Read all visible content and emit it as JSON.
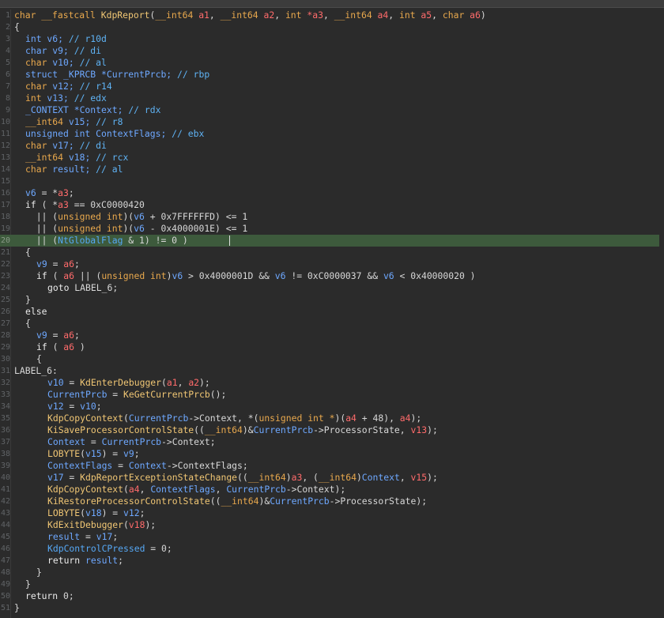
{
  "editor": {
    "highlighted_line": 20,
    "lines": [
      {
        "n": "1",
        "indent": 0,
        "t": [
          [
            "ty",
            "char __fastcall "
          ],
          [
            "fn",
            "KdpReport"
          ],
          [
            "pl",
            "("
          ],
          [
            "ty",
            "__int64"
          ],
          [
            "ar",
            " a1"
          ],
          [
            "pl",
            ", "
          ],
          [
            "ty",
            "__int64"
          ],
          [
            "ar",
            " a2"
          ],
          [
            "pl",
            ", "
          ],
          [
            "ty",
            "int"
          ],
          [
            "ar",
            " *a3"
          ],
          [
            "pl",
            ", "
          ],
          [
            "ty",
            "__int64"
          ],
          [
            "ar",
            " a4"
          ],
          [
            "pl",
            ", "
          ],
          [
            "ty",
            "int"
          ],
          [
            "ar",
            " a5"
          ],
          [
            "pl",
            ", "
          ],
          [
            "ty",
            "char"
          ],
          [
            "ar",
            " a6"
          ],
          [
            "pl",
            ")"
          ]
        ]
      },
      {
        "n": "2",
        "indent": 0,
        "t": [
          [
            "pl",
            "{"
          ]
        ]
      },
      {
        "n": "3",
        "indent": 1,
        "t": [
          [
            "lv",
            "int v6; "
          ],
          [
            "cm",
            "// r10d"
          ]
        ]
      },
      {
        "n": "4",
        "indent": 1,
        "t": [
          [
            "lv",
            "char v9; "
          ],
          [
            "cm",
            "// di"
          ]
        ]
      },
      {
        "n": "5",
        "indent": 1,
        "t": [
          [
            "ty",
            "char"
          ],
          [
            "lv",
            " v10; "
          ],
          [
            "cm",
            "// al"
          ]
        ]
      },
      {
        "n": "6",
        "indent": 1,
        "t": [
          [
            "lv",
            "struct _KPRCB *CurrentPrcb; "
          ],
          [
            "cm",
            "// rbp"
          ]
        ]
      },
      {
        "n": "7",
        "indent": 1,
        "t": [
          [
            "ty",
            "char"
          ],
          [
            "lv",
            " v12; "
          ],
          [
            "cm",
            "// r14"
          ]
        ]
      },
      {
        "n": "8",
        "indent": 1,
        "t": [
          [
            "ty",
            "int"
          ],
          [
            "lv",
            " v13; "
          ],
          [
            "cm",
            "// edx"
          ]
        ]
      },
      {
        "n": "9",
        "indent": 1,
        "t": [
          [
            "lv",
            "_CONTEXT *Context; "
          ],
          [
            "cm",
            "// rdx"
          ]
        ]
      },
      {
        "n": "10",
        "indent": 1,
        "t": [
          [
            "ty",
            "__int64"
          ],
          [
            "lv",
            " v15; "
          ],
          [
            "cm",
            "// r8"
          ]
        ]
      },
      {
        "n": "11",
        "indent": 1,
        "t": [
          [
            "lv",
            "unsigned int ContextFlags; "
          ],
          [
            "cm",
            "// ebx"
          ]
        ]
      },
      {
        "n": "12",
        "indent": 1,
        "t": [
          [
            "ty",
            "char"
          ],
          [
            "lv",
            " v17; "
          ],
          [
            "cm",
            "// di"
          ]
        ]
      },
      {
        "n": "13",
        "indent": 1,
        "t": [
          [
            "ty",
            "__int64"
          ],
          [
            "lv",
            " v18; "
          ],
          [
            "cm",
            "// rcx"
          ]
        ]
      },
      {
        "n": "14",
        "indent": 1,
        "t": [
          [
            "ty",
            "char"
          ],
          [
            "lv",
            " result; "
          ],
          [
            "cm",
            "// al"
          ]
        ]
      },
      {
        "n": "15",
        "indent": 0,
        "t": []
      },
      {
        "n": "16",
        "indent": 1,
        "t": [
          [
            "lv",
            "v6"
          ],
          [
            "pl",
            " = *"
          ],
          [
            "ar",
            "a3"
          ],
          [
            "pl",
            ";"
          ]
        ]
      },
      {
        "n": "17",
        "indent": 1,
        "t": [
          [
            "kw",
            "if"
          ],
          [
            "pl",
            " ( *"
          ],
          [
            "ar",
            "a3"
          ],
          [
            "pl",
            " == 0xC0000420"
          ]
        ]
      },
      {
        "n": "18",
        "indent": 1,
        "t": [
          [
            "pl",
            "  || ("
          ],
          [
            "ty",
            "unsigned int"
          ],
          [
            "pl",
            ")("
          ],
          [
            "lv",
            "v6"
          ],
          [
            "pl",
            " + 0x7FFFFFFD) <= 1"
          ]
        ]
      },
      {
        "n": "19",
        "indent": 1,
        "t": [
          [
            "pl",
            "  || ("
          ],
          [
            "ty",
            "unsigned int"
          ],
          [
            "pl",
            ")("
          ],
          [
            "lv",
            "v6"
          ],
          [
            "pl",
            " - 0x4000001E) <= 1"
          ]
        ]
      },
      {
        "n": "20",
        "indent": 1,
        "t": [
          [
            "pl",
            "  || ("
          ],
          [
            "gl",
            "NtGlobalFlag"
          ],
          [
            "pl",
            " & 1) != 0 )"
          ]
        ],
        "caret": true
      },
      {
        "n": "21",
        "indent": 1,
        "t": [
          [
            "pl",
            "{"
          ]
        ]
      },
      {
        "n": "22",
        "indent": 2,
        "t": [
          [
            "lv",
            "v9"
          ],
          [
            "pl",
            " = "
          ],
          [
            "ar",
            "a6"
          ],
          [
            "pl",
            ";"
          ]
        ]
      },
      {
        "n": "23",
        "indent": 2,
        "t": [
          [
            "kw",
            "if"
          ],
          [
            "pl",
            " ( "
          ],
          [
            "ar",
            "a6"
          ],
          [
            "pl",
            " || ("
          ],
          [
            "ty",
            "unsigned int"
          ],
          [
            "pl",
            ")"
          ],
          [
            "lv",
            "v6"
          ],
          [
            "pl",
            " > 0x4000001D && "
          ],
          [
            "lv",
            "v6"
          ],
          [
            "pl",
            " != 0xC0000037 && "
          ],
          [
            "lv",
            "v6"
          ],
          [
            "pl",
            " < 0x40000020 )"
          ]
        ]
      },
      {
        "n": "24",
        "indent": 3,
        "t": [
          [
            "kw",
            "goto"
          ],
          [
            "lb",
            " LABEL_6"
          ],
          [
            "pl",
            ";"
          ]
        ]
      },
      {
        "n": "25",
        "indent": 1,
        "t": [
          [
            "pl",
            "}"
          ]
        ]
      },
      {
        "n": "26",
        "indent": 1,
        "t": [
          [
            "kw",
            "else"
          ]
        ]
      },
      {
        "n": "27",
        "indent": 1,
        "t": [
          [
            "pl",
            "{"
          ]
        ]
      },
      {
        "n": "28",
        "indent": 2,
        "t": [
          [
            "lv",
            "v9"
          ],
          [
            "pl",
            " = "
          ],
          [
            "ar",
            "a6"
          ],
          [
            "pl",
            ";"
          ]
        ]
      },
      {
        "n": "29",
        "indent": 2,
        "t": [
          [
            "kw",
            "if"
          ],
          [
            "pl",
            " ( "
          ],
          [
            "ar",
            "a6"
          ],
          [
            "pl",
            " )"
          ]
        ]
      },
      {
        "n": "30",
        "indent": 2,
        "t": [
          [
            "pl",
            "{"
          ]
        ]
      },
      {
        "n": "31",
        "indent": 0,
        "t": [
          [
            "lb",
            "LABEL_6:"
          ]
        ]
      },
      {
        "n": "32",
        "indent": 3,
        "t": [
          [
            "lv",
            "v10"
          ],
          [
            "pl",
            " = "
          ],
          [
            "fn",
            "KdEnterDebugger"
          ],
          [
            "pl",
            "("
          ],
          [
            "ar",
            "a1"
          ],
          [
            "pl",
            ", "
          ],
          [
            "ar",
            "a2"
          ],
          [
            "pl",
            ");"
          ]
        ]
      },
      {
        "n": "33",
        "indent": 3,
        "t": [
          [
            "lv",
            "CurrentPrcb"
          ],
          [
            "pl",
            " = "
          ],
          [
            "fn",
            "KeGetCurrentPrcb"
          ],
          [
            "pl",
            "();"
          ]
        ]
      },
      {
        "n": "34",
        "indent": 3,
        "t": [
          [
            "lv",
            "v12"
          ],
          [
            "pl",
            " = "
          ],
          [
            "lv",
            "v10"
          ],
          [
            "pl",
            ";"
          ]
        ]
      },
      {
        "n": "35",
        "indent": 3,
        "t": [
          [
            "fn",
            "KdpCopyContext"
          ],
          [
            "pl",
            "("
          ],
          [
            "lv",
            "CurrentPrcb"
          ],
          [
            "pl",
            "->Context, *("
          ],
          [
            "ty",
            "unsigned int *"
          ],
          [
            "pl",
            ")("
          ],
          [
            "ar",
            "a4"
          ],
          [
            "pl",
            " + 48), "
          ],
          [
            "ar",
            "a4"
          ],
          [
            "pl",
            ");"
          ]
        ]
      },
      {
        "n": "36",
        "indent": 3,
        "t": [
          [
            "fn",
            "KiSaveProcessorControlState"
          ],
          [
            "pl",
            "(("
          ],
          [
            "ty",
            "__int64"
          ],
          [
            "pl",
            ")&"
          ],
          [
            "lv",
            "CurrentPrcb"
          ],
          [
            "pl",
            "->ProcessorState, "
          ],
          [
            "ar",
            "v13"
          ],
          [
            "pl",
            ");"
          ]
        ]
      },
      {
        "n": "37",
        "indent": 3,
        "t": [
          [
            "lv",
            "Context"
          ],
          [
            "pl",
            " = "
          ],
          [
            "lv",
            "CurrentPrcb"
          ],
          [
            "pl",
            "->Context;"
          ]
        ]
      },
      {
        "n": "38",
        "indent": 3,
        "t": [
          [
            "fn",
            "LOBYTE"
          ],
          [
            "pl",
            "("
          ],
          [
            "lv",
            "v15"
          ],
          [
            "pl",
            ") = "
          ],
          [
            "lv",
            "v9"
          ],
          [
            "pl",
            ";"
          ]
        ]
      },
      {
        "n": "39",
        "indent": 3,
        "t": [
          [
            "lv",
            "ContextFlags"
          ],
          [
            "pl",
            " = "
          ],
          [
            "lv",
            "Context"
          ],
          [
            "pl",
            "->ContextFlags;"
          ]
        ]
      },
      {
        "n": "40",
        "indent": 3,
        "t": [
          [
            "lv",
            "v17"
          ],
          [
            "pl",
            " = "
          ],
          [
            "fn",
            "KdpReportExceptionStateChange"
          ],
          [
            "pl",
            "(("
          ],
          [
            "ty",
            "__int64"
          ],
          [
            "pl",
            ")"
          ],
          [
            "ar",
            "a3"
          ],
          [
            "pl",
            ", ("
          ],
          [
            "ty",
            "__int64"
          ],
          [
            "pl",
            ")"
          ],
          [
            "lv",
            "Context"
          ],
          [
            "pl",
            ", "
          ],
          [
            "ar",
            "v15"
          ],
          [
            "pl",
            ");"
          ]
        ]
      },
      {
        "n": "41",
        "indent": 3,
        "t": [
          [
            "fn",
            "KdpCopyContext"
          ],
          [
            "pl",
            "("
          ],
          [
            "ar",
            "a4"
          ],
          [
            "pl",
            ", "
          ],
          [
            "lv",
            "ContextFlags"
          ],
          [
            "pl",
            ", "
          ],
          [
            "lv",
            "CurrentPrcb"
          ],
          [
            "pl",
            "->Context);"
          ]
        ]
      },
      {
        "n": "42",
        "indent": 3,
        "t": [
          [
            "fn",
            "KiRestoreProcessorControlState"
          ],
          [
            "pl",
            "(("
          ],
          [
            "ty",
            "__int64"
          ],
          [
            "pl",
            ")&"
          ],
          [
            "lv",
            "CurrentPrcb"
          ],
          [
            "pl",
            "->ProcessorState);"
          ]
        ]
      },
      {
        "n": "43",
        "indent": 3,
        "t": [
          [
            "fn",
            "LOBYTE"
          ],
          [
            "pl",
            "("
          ],
          [
            "lv",
            "v18"
          ],
          [
            "pl",
            ") = "
          ],
          [
            "lv",
            "v12"
          ],
          [
            "pl",
            ";"
          ]
        ]
      },
      {
        "n": "44",
        "indent": 3,
        "t": [
          [
            "fn",
            "KdExitDebugger"
          ],
          [
            "pl",
            "("
          ],
          [
            "ar",
            "v18"
          ],
          [
            "pl",
            ");"
          ]
        ]
      },
      {
        "n": "45",
        "indent": 3,
        "t": [
          [
            "lv",
            "result"
          ],
          [
            "pl",
            " = "
          ],
          [
            "lv",
            "v17"
          ],
          [
            "pl",
            ";"
          ]
        ]
      },
      {
        "n": "46",
        "indent": 3,
        "t": [
          [
            "gl",
            "KdpControlCPressed"
          ],
          [
            "pl",
            " = 0;"
          ]
        ]
      },
      {
        "n": "47",
        "indent": 3,
        "t": [
          [
            "kw",
            "return"
          ],
          [
            "pl",
            " "
          ],
          [
            "lv",
            "result"
          ],
          [
            "pl",
            ";"
          ]
        ]
      },
      {
        "n": "48",
        "indent": 2,
        "t": [
          [
            "pl",
            "}"
          ]
        ]
      },
      {
        "n": "49",
        "indent": 1,
        "t": [
          [
            "pl",
            "}"
          ]
        ]
      },
      {
        "n": "50",
        "indent": 1,
        "t": [
          [
            "kw",
            "return"
          ],
          [
            "pl",
            " 0;"
          ]
        ]
      },
      {
        "n": "51",
        "indent": 0,
        "t": [
          [
            "pl",
            "}"
          ]
        ]
      }
    ]
  }
}
